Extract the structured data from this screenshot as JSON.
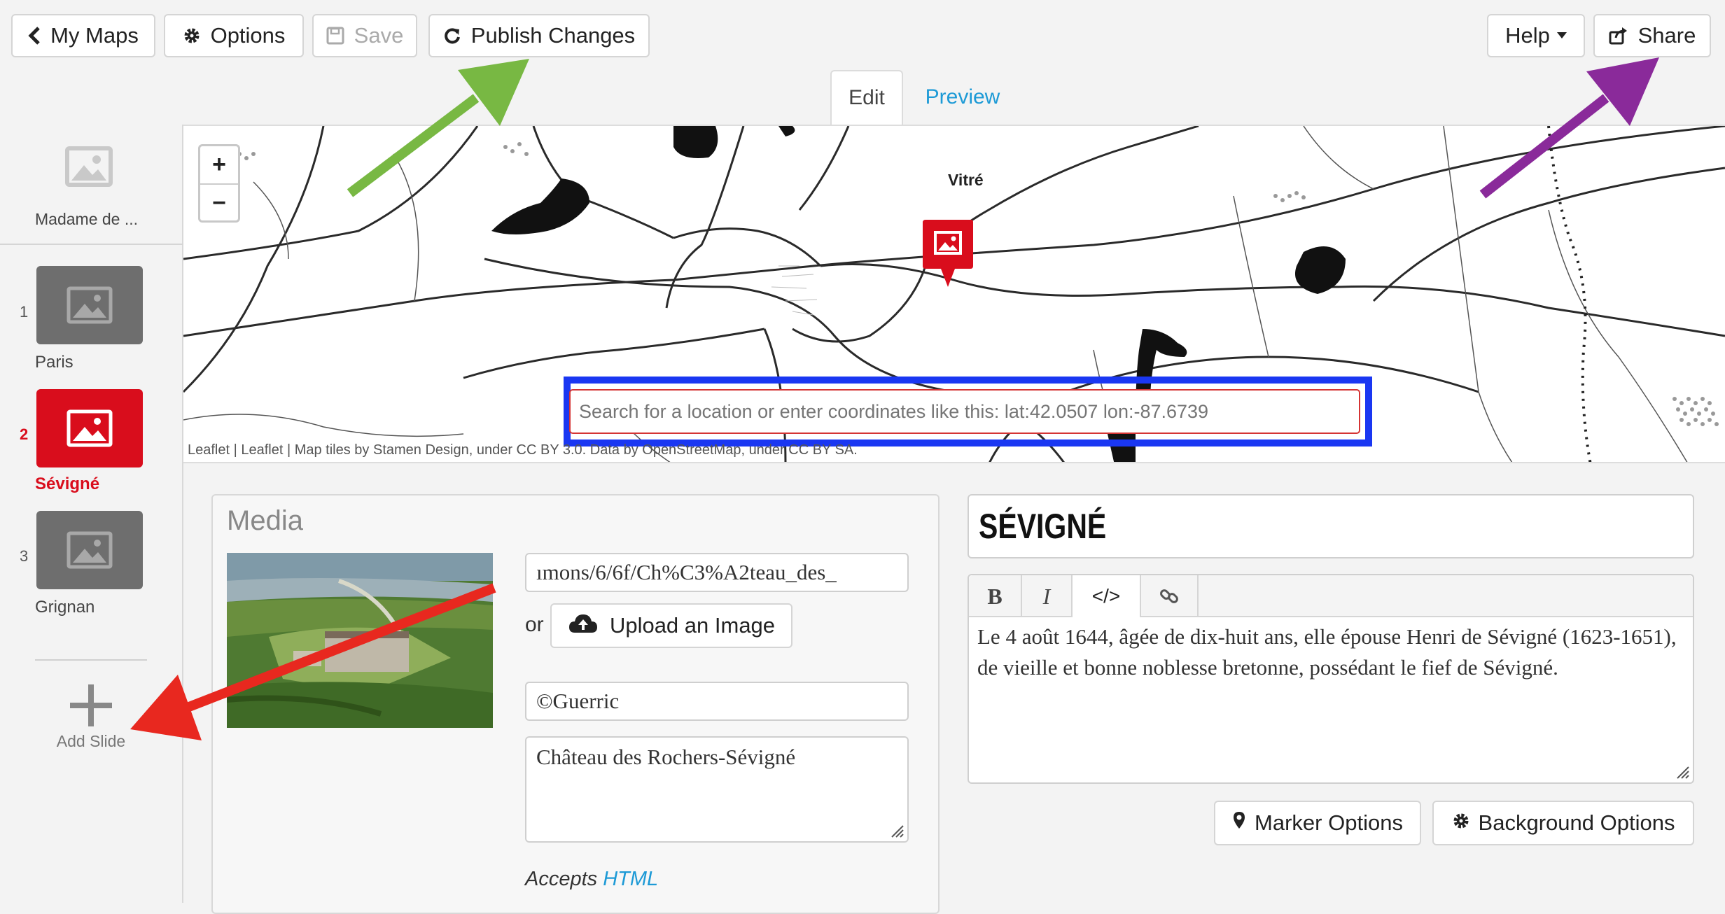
{
  "toolbar": {
    "my_maps": "My Maps",
    "options": "Options",
    "save": "Save",
    "publish": "Publish Changes",
    "help": "Help",
    "share": "Share"
  },
  "tabs": {
    "edit": "Edit",
    "preview": "Preview"
  },
  "sidebar": {
    "title_slide": "Madame de ...",
    "slides": [
      {
        "num": "1",
        "label": "Paris"
      },
      {
        "num": "2",
        "label": "Sévigné"
      },
      {
        "num": "3",
        "label": "Grignan"
      }
    ],
    "add_slide": "Add Slide"
  },
  "map": {
    "town_label": "Vitré",
    "search_placeholder": "Search for a location or enter coordinates like this: lat:42.0507 lon:-87.6739",
    "attribution": "Leaflet | Leaflet | Map tiles by Stamen Design, under CC BY 3.0. Data by OpenStreetMap, under CC BY SA."
  },
  "media": {
    "heading": "Media",
    "url_value": "ımons/6/6f/Ch%C3%A2teau_des_",
    "or": "or",
    "upload": "Upload an Image",
    "credit": "©Guerric",
    "caption": "Château des Rochers-Sévigné",
    "accepts": "Accepts",
    "html_link": "HTML"
  },
  "text": {
    "headline": "SÉVIGNÉ",
    "editor": {
      "bold": "B",
      "italic": "I",
      "code": "</>"
    },
    "body": "Le 4 août 1644, âgée de dix-huit ans, elle épouse Henri de Sévigné (1623-1651), de vieille et bonne noblesse bretonne, possédant le fief de Sévigné."
  },
  "options": {
    "marker": "Marker Options",
    "background": "Background Options"
  },
  "colors": {
    "accent_red": "#d90d1c",
    "link_blue": "#1d9ad6",
    "arrow_green": "#78b843",
    "arrow_purple": "#8a2a9a",
    "arrow_red": "#e8281f",
    "highlight_blue": "#1a37f2"
  }
}
